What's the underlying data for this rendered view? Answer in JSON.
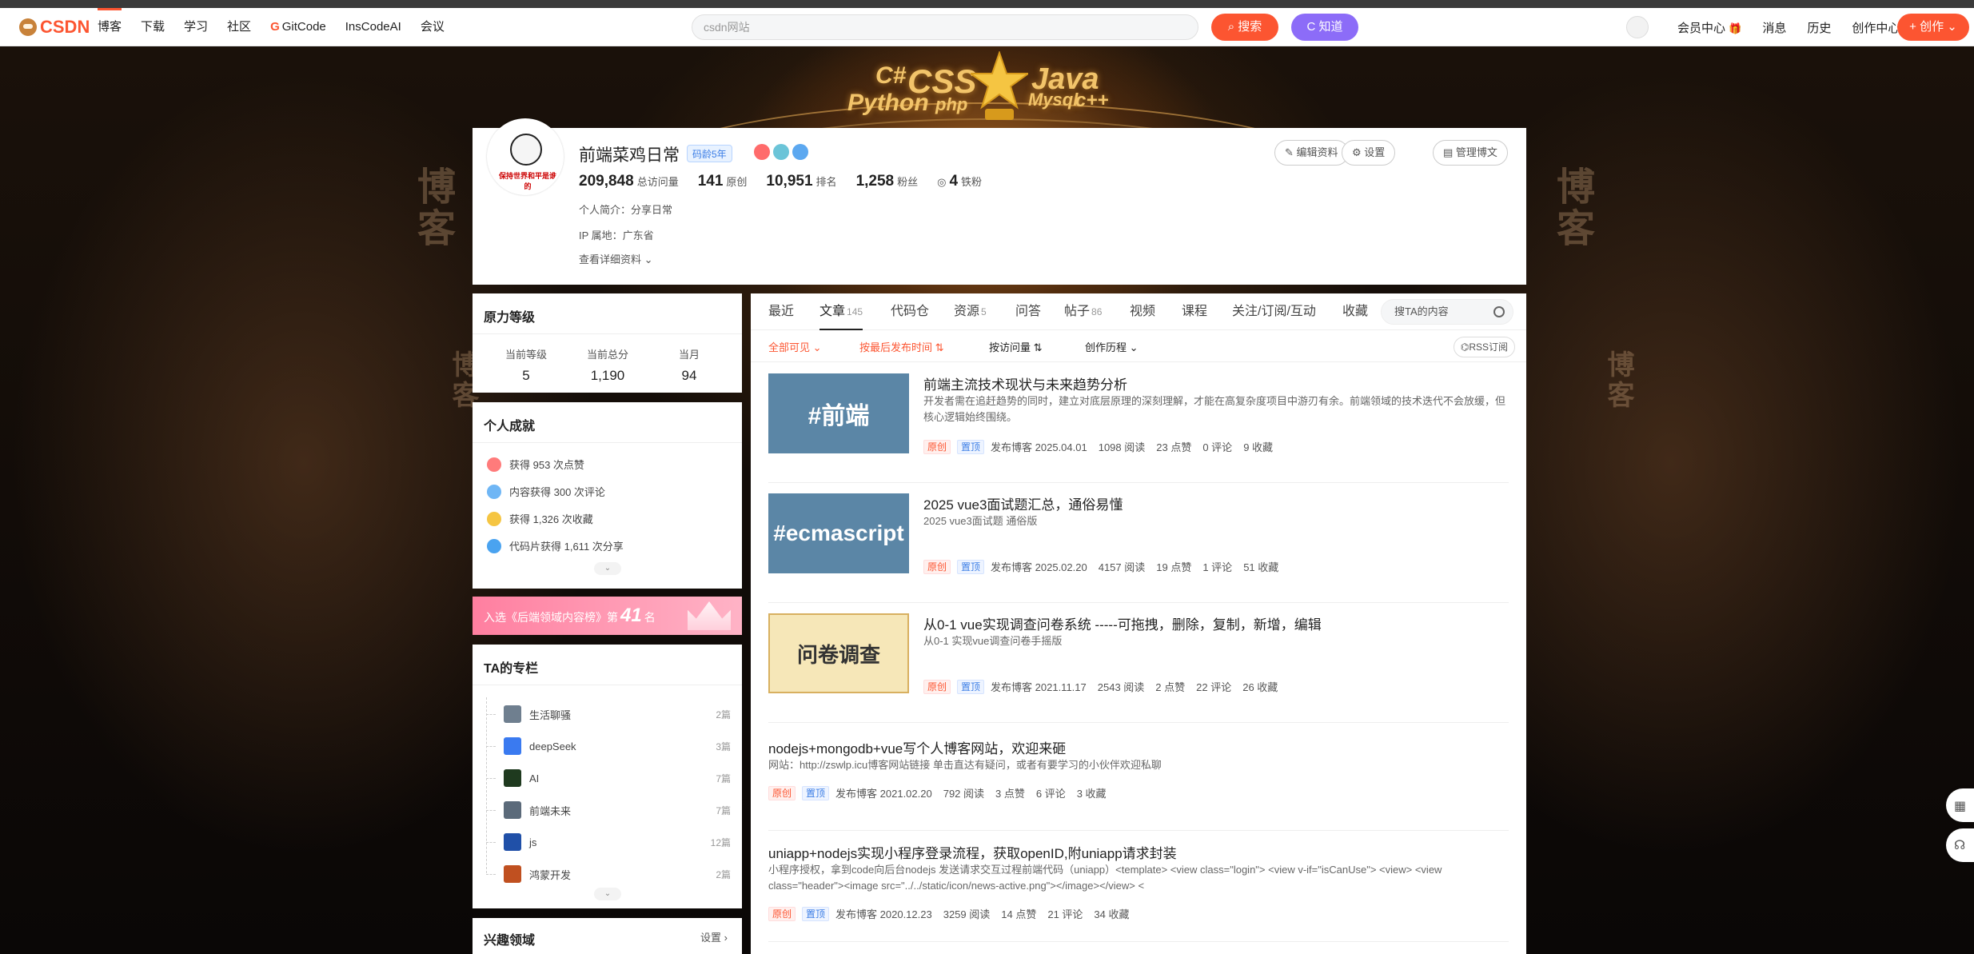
{
  "topbar": {
    "logo": "CSDN",
    "nav": [
      "博客",
      "下载",
      "学习",
      "社区",
      "GitCode",
      "InsCodeAI",
      "会议"
    ],
    "search_placeholder": "csdn网站",
    "search_btn": "搜索",
    "zhidao_btn": "知道",
    "right": [
      "会员中心",
      "消息",
      "历史",
      "创作中心"
    ],
    "create_btn": "创作"
  },
  "banner": {
    "words": [
      "C#",
      "CSS",
      "Java",
      "Python",
      "php",
      "Mysql",
      "c++"
    ],
    "side_text": "博客"
  },
  "profile": {
    "name": "前端菜鸡日常",
    "age_badge": "码龄5年",
    "avatar_caption": "保持世界和平是谁的",
    "stats": [
      {
        "value": "209,848",
        "label": "总访问量"
      },
      {
        "value": "141",
        "label": "原创"
      },
      {
        "value": "10,951",
        "label": "排名"
      },
      {
        "value": "1,258",
        "label": "粉丝"
      },
      {
        "value": "4",
        "label": "铁粉"
      }
    ],
    "intro": "个人简介：分享日常",
    "ip": "IP 属地：广东省",
    "detail_link": "查看详细资料",
    "buttons": [
      "编辑资料",
      "设置",
      "管理博文"
    ]
  },
  "rank": {
    "title": "原力等级",
    "cols": [
      {
        "label": "当前等级",
        "value": "5"
      },
      {
        "label": "当前总分",
        "value": "1,190"
      },
      {
        "label": "当月",
        "value": "94"
      }
    ]
  },
  "achievements": {
    "title": "个人成就",
    "items": [
      "获得 953 次点赞",
      "内容获得 300 次评论",
      "获得 1,326 次收藏",
      "代码片获得 1,611 次分享"
    ]
  },
  "rank_banner": {
    "prefix": "入选《后端领域内容榜》第",
    "num": "41",
    "suffix": "名"
  },
  "columns": {
    "title": "TA的专栏",
    "items": [
      {
        "name": "生活聊骚",
        "count": "2篇"
      },
      {
        "name": "deepSeek",
        "count": "3篇"
      },
      {
        "name": "AI",
        "count": "7篇"
      },
      {
        "name": "前端未来",
        "count": "7篇"
      },
      {
        "name": "js",
        "count": "12篇"
      },
      {
        "name": "鸿蒙开发",
        "count": "2篇"
      }
    ]
  },
  "interest": {
    "title": "兴趣领域",
    "settings": "设置"
  },
  "tabs": [
    {
      "label": "最近",
      "n": ""
    },
    {
      "label": "文章",
      "n": "145"
    },
    {
      "label": "代码仓",
      "n": ""
    },
    {
      "label": "资源",
      "n": "5"
    },
    {
      "label": "问答",
      "n": ""
    },
    {
      "label": "帖子",
      "n": "86"
    },
    {
      "label": "视频",
      "n": ""
    },
    {
      "label": "课程",
      "n": ""
    },
    {
      "label": "关注/订阅/互动",
      "n": ""
    },
    {
      "label": "收藏",
      "n": ""
    }
  ],
  "tab_search_placeholder": "搜TA的内容",
  "filters": {
    "visible": "全部可见",
    "sort_time": "按最后发布时间",
    "sort_views": "按访问量",
    "history": "创作历程",
    "rss": "RSS订阅"
  },
  "articles": [
    {
      "cover": "#前端",
      "title": "前端主流技术现状与未来趋势分析",
      "desc": "开发者需在追赶趋势的同时，建立对底层原理的深刻理解，才能在高复杂度项目中游刃有余。前端领域的技术迭代不会放缓，但核心逻辑始终围绕。",
      "tag1": "原创",
      "tag2": "置顶",
      "date": "发布博客 2025.04.01",
      "reads": "1098 阅读",
      "likes": "23 点赞",
      "comments": "0 评论",
      "favs": "9 收藏"
    },
    {
      "cover": "#ecmascript",
      "title": "2025 vue3面试题汇总，通俗易懂",
      "desc": "2025 vue3面试题 通俗版",
      "tag1": "原创",
      "tag2": "置顶",
      "date": "发布博客 2025.02.20",
      "reads": "4157 阅读",
      "likes": "19 点赞",
      "comments": "1 评论",
      "favs": "51 收藏"
    },
    {
      "cover": "问卷调查",
      "title": "从0-1 vue实现调查问卷系统 -----可拖拽，删除，复制，新增，编辑",
      "desc": "从0-1 实现vue调查问卷手摇版",
      "tag1": "原创",
      "tag2": "置顶",
      "date": "发布博客 2021.11.17",
      "reads": "2543 阅读",
      "likes": "2 点赞",
      "comments": "22 评论",
      "favs": "26 收藏"
    },
    {
      "cover": "",
      "title": "nodejs+mongodb+vue写个人博客网站，欢迎来砸",
      "desc": "网站：http://zswlp.icu博客网站链接 单击直达有疑问，或者有要学习的小伙伴欢迎私聊",
      "tag1": "原创",
      "tag2": "置顶",
      "date": "发布博客 2021.02.20",
      "reads": "792 阅读",
      "likes": "3 点赞",
      "comments": "6 评论",
      "favs": "3 收藏"
    },
    {
      "cover": "",
      "title": "uniapp+nodejs实现小程序登录流程，获取openID,附uniapp请求封装",
      "desc": "小程序授权，拿到code向后台nodejs 发送请求交互过程前端代码（uniapp）<template> <view class=\"login\"> <view v-if=\"isCanUse\"> <view> <view class=\"header\"><image src=\"../../static/icon/news-active.png\"></image></view> <",
      "tag1": "原创",
      "tag2": "置顶",
      "date": "发布博客 2020.12.23",
      "reads": "3259 阅读",
      "likes": "14 点赞",
      "comments": "21 评论",
      "favs": "34 收藏"
    }
  ]
}
